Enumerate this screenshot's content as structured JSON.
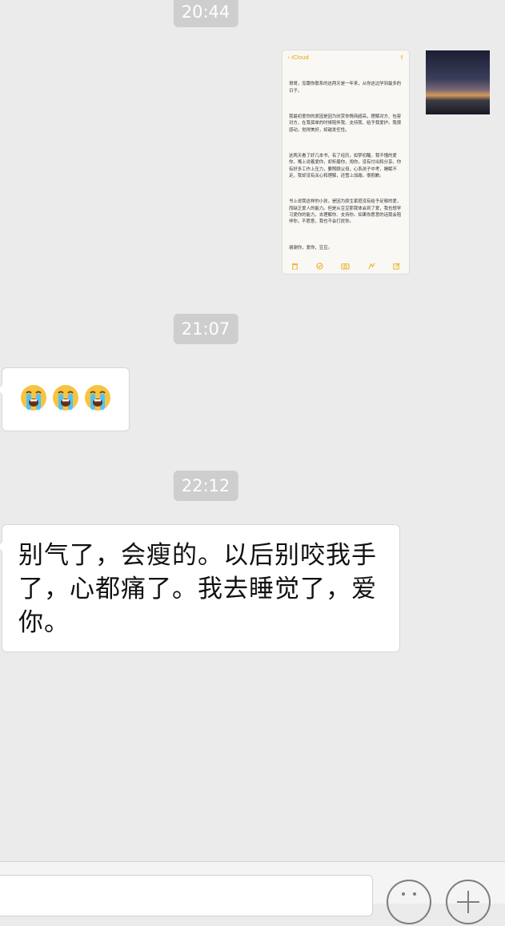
{
  "chat": {
    "timestamps": [
      "20:44",
      "21:07",
      "22:12"
    ],
    "emoji_message": [
      "😭",
      "😭",
      "😭"
    ],
    "text_message": "别气了，会瘦的。以后别咬我手了，心都痛了。我去睡觉了，爱你。"
  },
  "notes_screenshot": {
    "back_label": "iCloud",
    "paragraphs": [
      "哥哥，没跟你联系的这两天是一年来，从你这边学到最多的日子。",
      "我最初爱你的原因是因为欣赏你情商超高，理解对方、包容对方，在我孤单的时候陪伴我、支持我、给予我爱护。我很感动，觉得美好，却越发任性。",
      "这两天看了好几本书，有了经历，如梦初醒。我不懂的爱你，嘴上说着爱你，却折磨你，闹你，没有付出和分享。你有好多工作上压力，要照顾父母，心系孩子中考，睡眠不足，我却没有关心和理解，还雪上加霜。很抱歉。",
      "书上说我这样的小孩，是因为原生家庭没有给予足够的爱，而缺乏爱人的能力。但是从豆豆那我体会到了爱，我也想学习爱你的能力，去理解你、支持你。如果你愿意的话我会陪伴你，不愿意，我也不会打扰你。",
      "谢谢你，爱你，豆豆。"
    ]
  },
  "input": {
    "placeholder": ""
  },
  "colors": {
    "background": "#ebebeb",
    "timestamp_bg": "#cecece",
    "bubble_bg": "#ffffff",
    "notes_accent": "#e6a400"
  },
  "icons": [
    "back-chevron-icon",
    "share-icon",
    "trash-icon",
    "checklist-icon",
    "camera-icon",
    "sketch-icon",
    "compose-icon",
    "emoji-icon",
    "plus-icon"
  ]
}
